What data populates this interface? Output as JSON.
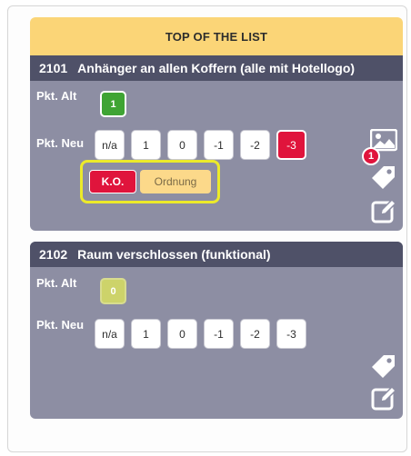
{
  "banner": {
    "title": "TOP OF THE LIST"
  },
  "items": [
    {
      "number": "2101",
      "title": "Anhänger an allen Koffern (alle mit Hotellogo)",
      "alt_label": "Pkt. Alt",
      "alt_value": "1",
      "neu_label": "Pkt. Neu",
      "scores": [
        "n/a",
        "1",
        "0",
        "-1",
        "-2",
        "-3"
      ],
      "selected_score": "-3",
      "ko_label": "K.O.",
      "order_label": "Ordnung",
      "image_badge_count": "1"
    },
    {
      "number": "2102",
      "title": "Raum verschlossen (funktional)",
      "alt_label": "Pkt. Alt",
      "alt_value": "0",
      "neu_label": "Pkt. Neu",
      "scores": [
        "n/a",
        "1",
        "0",
        "-1",
        "-2",
        "-3"
      ]
    }
  ],
  "colors": {
    "banner": "#fbd577",
    "card_header": "#4f5168",
    "card_body": "#8d8ea3",
    "alt_green": "#3fa434",
    "alt_yellow": "#cdd36a",
    "selected_red": "#e0143c",
    "highlight_frame": "#ecea2a"
  },
  "icons": [
    "image-icon",
    "tag-icon",
    "edit-icon"
  ]
}
